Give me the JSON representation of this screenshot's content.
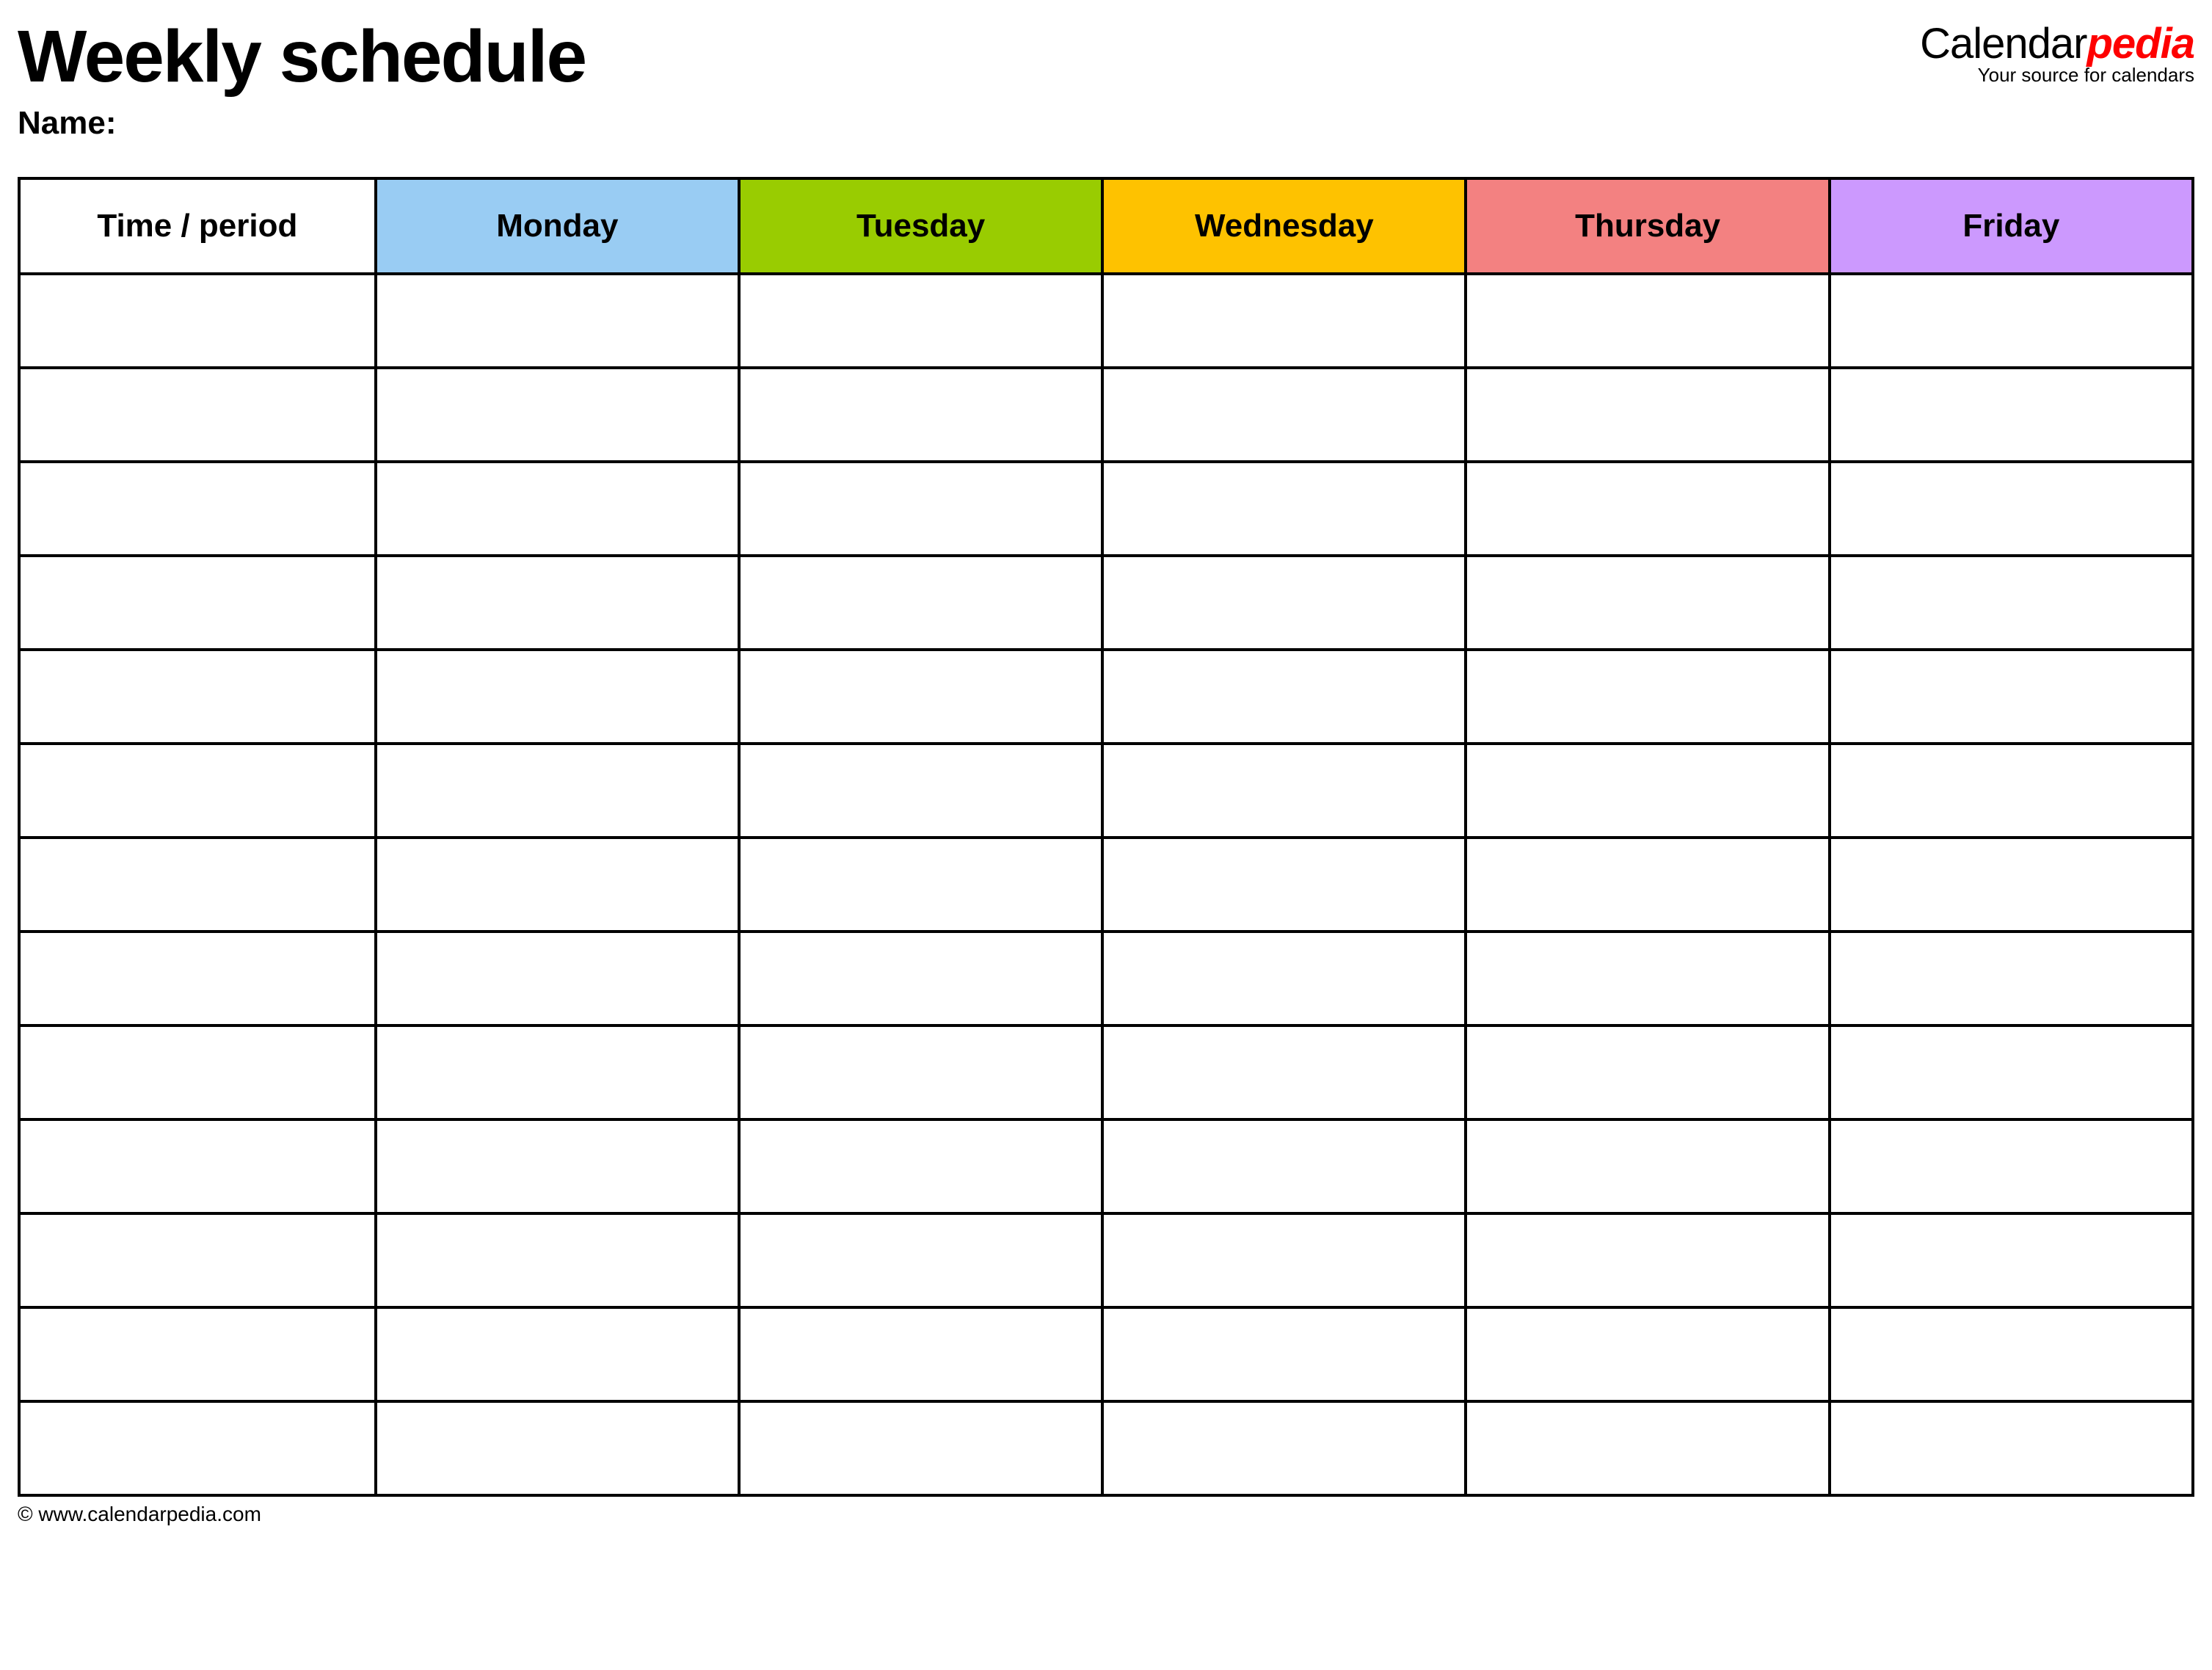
{
  "header": {
    "title": "Weekly schedule",
    "brand_prefix": "Calendar",
    "brand_suffix": "pedia",
    "brand_tagline": "Your source for calendars",
    "name_label": "Name:"
  },
  "table": {
    "time_header": "Time / period",
    "days": [
      {
        "label": "Monday",
        "color": "#99ccf3"
      },
      {
        "label": "Tuesday",
        "color": "#99cc01"
      },
      {
        "label": "Wednesday",
        "color": "#fec200"
      },
      {
        "label": "Thursday",
        "color": "#f38181"
      },
      {
        "label": "Friday",
        "color": "#cc99fe"
      }
    ],
    "row_count": 13
  },
  "footer": {
    "copyright": "© www.calendarpedia.com"
  }
}
